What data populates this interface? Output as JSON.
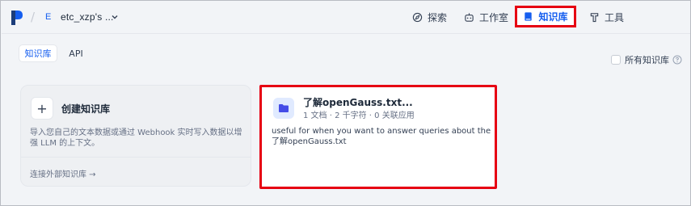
{
  "header": {
    "workspace_letter": "E",
    "workspace_name": "etc_xzp's ...",
    "nav": {
      "explore": "探索",
      "studio": "工作室",
      "datasets": "知识库",
      "tools": "工具"
    }
  },
  "tabs": {
    "datasets": "知识库",
    "api": "API"
  },
  "filter": {
    "all_datasets_label": "所有知识库",
    "all_datasets_checked": false
  },
  "create_card": {
    "plus": "+",
    "title": "创建知识库",
    "description": "导入您自己的文本数据或通过 Webhook 实时写入数据以增强 LLM 的上下文。",
    "connect_link": "连接外部知识库 →"
  },
  "dataset_card": {
    "name": "了解openGauss.txt...",
    "meta": "1 文档 · 2 千字符 · 0 关联应用",
    "description": "useful for when you want to answer queries about the 了解openGauss.txt"
  },
  "colors": {
    "accent": "#155eef",
    "highlight_border": "#e60012",
    "background": "#f2f4f7"
  }
}
